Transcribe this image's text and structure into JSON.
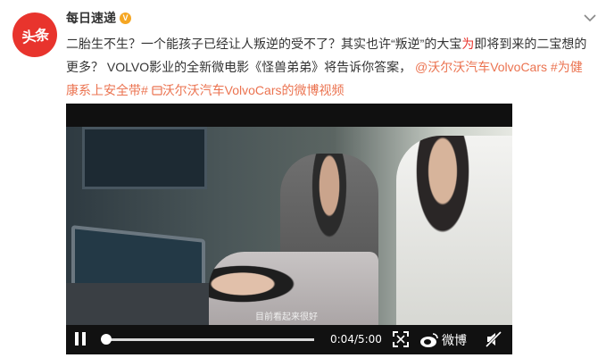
{
  "header": {
    "avatar_text": "头条",
    "username": "每日速递",
    "verified_mark": "V"
  },
  "post": {
    "text_part1": "二胎生不生？一个能孩子已经让人叛逆的受不了？其实也许“叛逆”的大宝",
    "text_highlight": "为",
    "text_part2": "即将到来的二宝想的更多？ VOLVO影业的全新微电影《怪兽弟弟》将告诉你答案，",
    "mention": "@沃尔沃汽车VolvoCars",
    "topic": "#为健康系上安全带#",
    "video_link_icon": "video-link-icon",
    "video_link": "沃尔沃汽车VolvoCars的微博视频"
  },
  "video": {
    "subtitle": "目前看起来很好",
    "time": "0:04/5:00",
    "progress": 0.013,
    "brand": "微博"
  },
  "colors": {
    "accent": "#eb7350",
    "avatar_bg": "#e8342d",
    "verified": "#f5a623"
  }
}
